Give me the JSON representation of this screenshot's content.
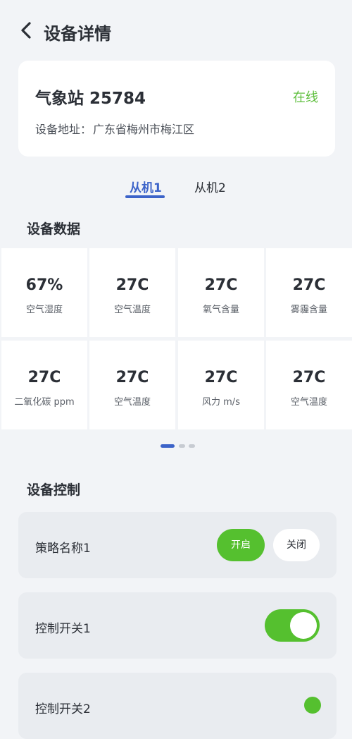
{
  "header": {
    "title": "设备详情"
  },
  "device": {
    "name": "气象站 25784",
    "status": "在线",
    "address_label": "设备地址：",
    "address": "广东省梅州市梅江区"
  },
  "tabs": [
    {
      "label": "从机1",
      "active": true
    },
    {
      "label": "从机2",
      "active": false
    }
  ],
  "data_section": {
    "title": "设备数据",
    "rows": [
      [
        {
          "value": "67%",
          "label": "空气湿度"
        },
        {
          "value": "27C",
          "label": "空气温度"
        },
        {
          "value": "27C",
          "label": "氧气含量"
        },
        {
          "value": "27C",
          "label": "雾霾含量"
        }
      ],
      [
        {
          "value": "27C",
          "label": "二氧化碳 ppm"
        },
        {
          "value": "27C",
          "label": "空气温度"
        },
        {
          "value": "27C",
          "label": "风力 m/s"
        },
        {
          "value": "27C",
          "label": "空气温度"
        }
      ]
    ],
    "page_indicator": {
      "pages": 3,
      "current": 1
    }
  },
  "control_section": {
    "title": "设备控制",
    "items": [
      {
        "name": "策略名称1",
        "on_label": "开启",
        "off_label": "关闭"
      },
      {
        "name": "控制开关1",
        "toggle_on": true
      },
      {
        "name": "控制开关2",
        "toggle_on": true
      }
    ]
  },
  "colors": {
    "accent": "#3c63c9",
    "online": "#5fbf3e",
    "switch_on": "#55c02f",
    "background": "#f2f4f7"
  }
}
